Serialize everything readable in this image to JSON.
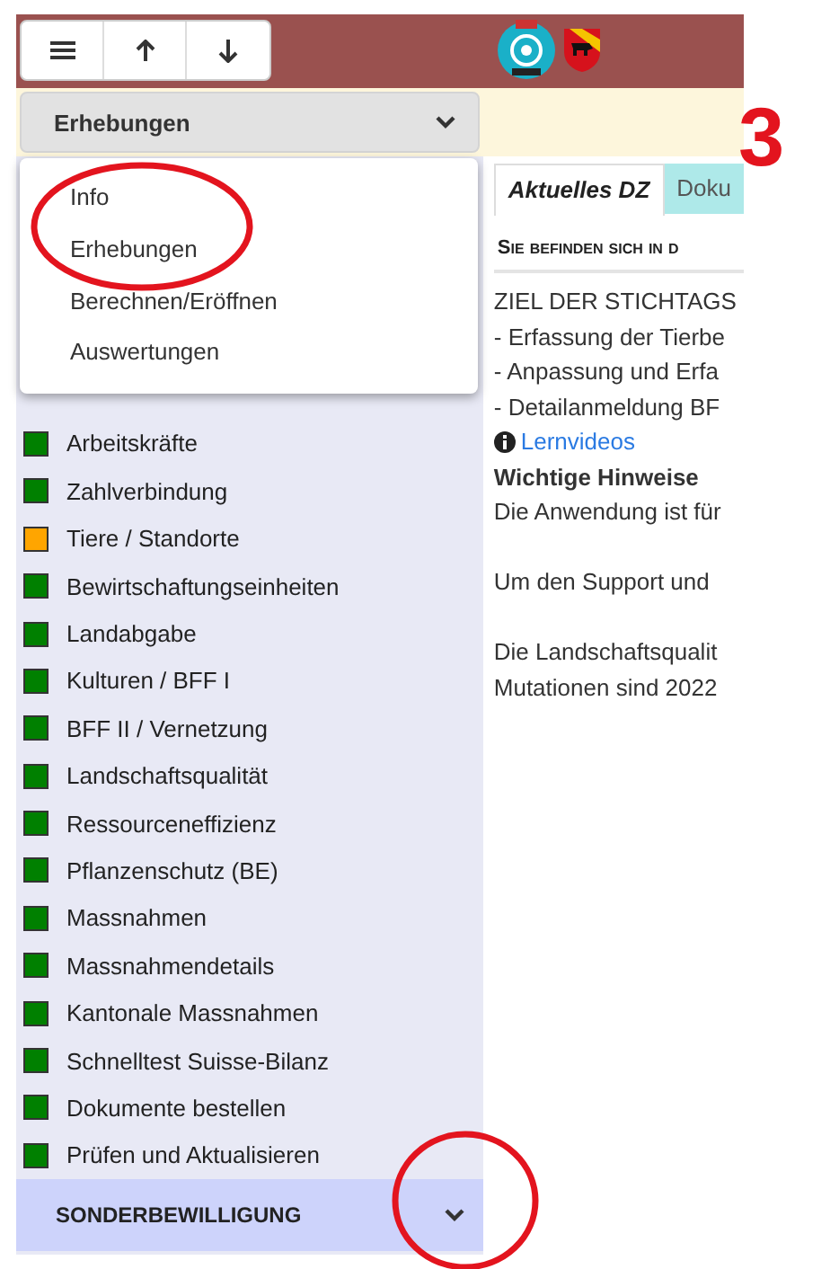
{
  "module_select": {
    "value": "Erhebungen"
  },
  "menu": {
    "items": [
      {
        "label": "Info"
      },
      {
        "label": "Erhebungen"
      },
      {
        "label": "Berechnen/Eröffnen"
      },
      {
        "label": "Auswertungen"
      }
    ]
  },
  "sidebar": {
    "items": [
      {
        "label": "Arbeitskräfte",
        "color": "#008000"
      },
      {
        "label": "Zahlverbindung",
        "color": "#008000"
      },
      {
        "label": "Tiere / Standorte",
        "color": "#ffa500"
      },
      {
        "label": "Bewirtschaftungseinheiten",
        "color": "#008000"
      },
      {
        "label": "Landabgabe",
        "color": "#008000"
      },
      {
        "label": "Kulturen / BFF I",
        "color": "#008000"
      },
      {
        "label": "BFF II / Vernetzung",
        "color": "#008000"
      },
      {
        "label": "Landschaftsqualität",
        "color": "#008000"
      },
      {
        "label": "Ressourceneffizienz",
        "color": "#008000"
      },
      {
        "label": "Pflanzenschutz (BE)",
        "color": "#008000"
      },
      {
        "label": "Massnahmen",
        "color": "#008000"
      },
      {
        "label": "Massnahmendetails",
        "color": "#008000"
      },
      {
        "label": "Kantonale Massnahmen",
        "color": "#008000"
      },
      {
        "label": "Schnelltest Suisse-Bilanz",
        "color": "#008000"
      },
      {
        "label": "Dokumente bestellen",
        "color": "#008000"
      },
      {
        "label": "Prüfen und Aktualisieren",
        "color": "#008000"
      }
    ],
    "section": {
      "label": "SONDERBEWILLIGUNG",
      "expanded": false
    }
  },
  "tabs": [
    {
      "label": "Aktuelles DZ",
      "selected": true
    },
    {
      "label": "Doku",
      "selected": false
    }
  ],
  "content": {
    "heading": "Sie befinden sich in d",
    "lines": [
      {
        "kind": "text",
        "text": "ZIEL DER STICHTAGS"
      },
      {
        "kind": "text",
        "text": "- Erfassung der Tierbe"
      },
      {
        "kind": "text",
        "text": "- Anpassung und Erfa"
      },
      {
        "kind": "text",
        "text": "- Detailanmeldung BF"
      },
      {
        "kind": "link",
        "text": "Lernvideos"
      },
      {
        "kind": "bold",
        "text": "Wichtige Hinweise"
      },
      {
        "kind": "text",
        "text": "Die Anwendung ist für"
      },
      {
        "kind": "gap"
      },
      {
        "kind": "text",
        "text": "Um den Support und"
      },
      {
        "kind": "gap"
      },
      {
        "kind": "text",
        "text": "Die Landschaftsqualit"
      },
      {
        "kind": "text",
        "text": "Mutationen sind 2022"
      }
    ]
  },
  "annotation": {
    "number": "3"
  }
}
